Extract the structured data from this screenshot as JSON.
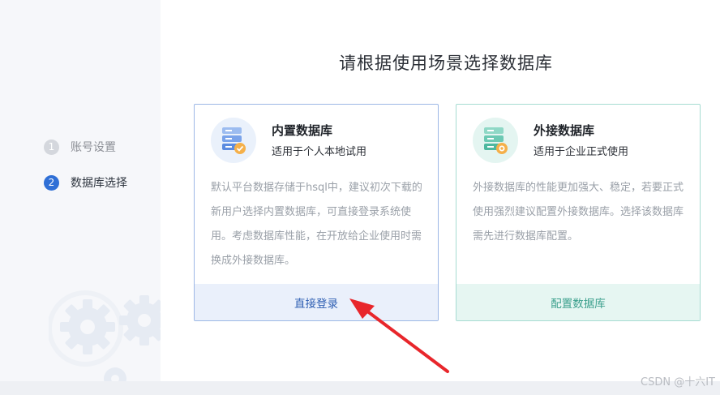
{
  "sidebar": {
    "steps": [
      {
        "number": "1",
        "label": "账号设置"
      },
      {
        "number": "2",
        "label": "数据库选择"
      }
    ]
  },
  "main": {
    "title": "请根据使用场景选择数据库",
    "cards": [
      {
        "title": "内置数据库",
        "subtitle": "适用于个人本地试用",
        "description": "默认平台数据存储于hsql中，建议初次下载的新用户选择内置数据库，可直接登录系统使用。考虑数据库性能，在开放给企业使用时需换成外接数据库。",
        "action": "直接登录"
      },
      {
        "title": "外接数据库",
        "subtitle": "适用于企业正式使用",
        "description": "外接数据库的性能更加强大、稳定，若要正式使用强烈建议配置外接数据库。选择该数据库需先进行数据库配置。",
        "action": "配置数据库"
      }
    ]
  },
  "watermark": "CSDN @十六IT",
  "colors": {
    "accent_blue": "#2f6fd6",
    "card_builtin_border": "#9db8e6",
    "card_external_border": "#a6dcd2",
    "arrow_red": "#e8262b"
  }
}
